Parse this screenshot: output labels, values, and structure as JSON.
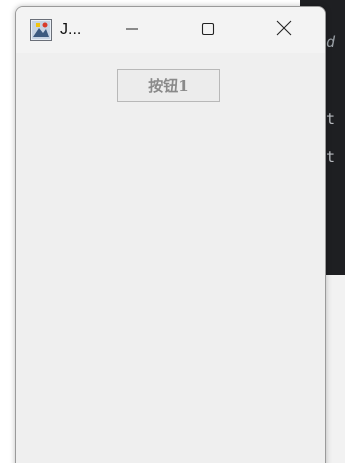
{
  "window": {
    "title": "J...",
    "buttons": {
      "minimize": "minimize-icon",
      "maximize": "maximize-icon",
      "close": "close-icon"
    }
  },
  "content": {
    "button1_label": "按钮1"
  },
  "background_editor": {
    "visible_chars": [
      "d",
      "t",
      "t"
    ]
  },
  "colors": {
    "window_bg": "#efefef",
    "titlebar_bg": "#f3f3f3",
    "editor_bg": "#1e1f22",
    "button_text": "#8a8a8a",
    "button_border": "#b8b8b8"
  }
}
